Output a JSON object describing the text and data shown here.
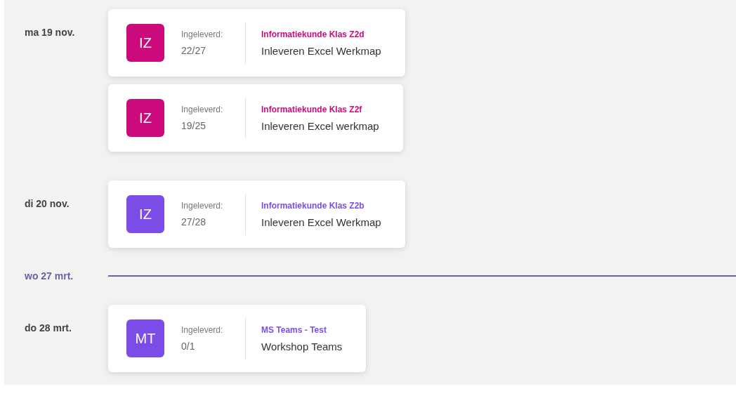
{
  "days": [
    {
      "kind": "day",
      "date": "ma 19 nov.",
      "assignments": [
        {
          "initials": "IZ",
          "color": "#cc0a7c",
          "submitted_label": "Ingeleverd:",
          "count": "22/27",
          "course": "Informatiekunde Klas Z2d",
          "title": "Inleveren Excel Werkmap"
        },
        {
          "initials": "IZ",
          "color": "#cc0a7c",
          "submitted_label": "Ingeleverd:",
          "count": "19/25",
          "course": "Informatiekunde Klas Z2f",
          "title": "Inleveren Excel werkmap"
        }
      ]
    },
    {
      "kind": "day",
      "date": "di 20 nov.",
      "assignments": [
        {
          "initials": "IZ",
          "color": "#7b4ce8",
          "submitted_label": "Ingeleverd:",
          "count": "27/28",
          "course": "Informatiekunde Klas Z2b",
          "title": "Inleveren Excel Werkmap"
        }
      ]
    },
    {
      "kind": "today",
      "date": "wo 27 mrt."
    },
    {
      "kind": "day",
      "date": "do 28 mrt.",
      "assignments": [
        {
          "initials": "MT",
          "color": "#7b4ce8",
          "submitted_label": "Ingeleverd:",
          "count": "0/1",
          "course": "MS Teams - Test",
          "title": "Workshop Teams"
        }
      ]
    }
  ]
}
